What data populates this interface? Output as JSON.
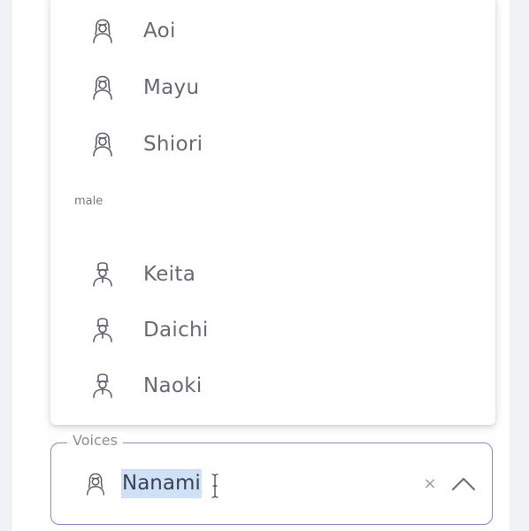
{
  "dropdown": {
    "female_options": [
      {
        "label": "Aoi",
        "icon": "female-voice-icon"
      },
      {
        "label": "Mayu",
        "icon": "female-voice-icon"
      },
      {
        "label": "Shiori",
        "icon": "female-voice-icon"
      }
    ],
    "group_label_male": "male",
    "male_options": [
      {
        "label": "Keita",
        "icon": "male-voice-icon"
      },
      {
        "label": "Daichi",
        "icon": "male-voice-icon"
      },
      {
        "label": "Naoki",
        "icon": "male-voice-icon"
      }
    ]
  },
  "field": {
    "legend": "Voices",
    "value": "Nanami",
    "value_icon": "female-voice-icon",
    "clear_glyph": "×",
    "toggle_icon": "chevron-up-icon"
  },
  "colors": {
    "field_border": "#8c86c9",
    "selection_highlight": "#cfe0f7",
    "option_text": "#666a73"
  }
}
